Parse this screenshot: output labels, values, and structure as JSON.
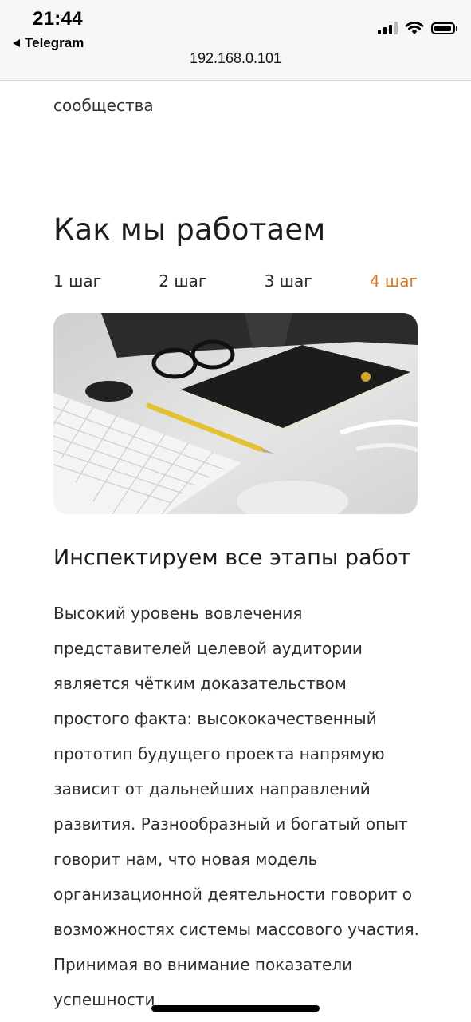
{
  "status_bar": {
    "time": "21:44",
    "back_app": "Telegram",
    "signal_icon": "cellular-signal-icon",
    "wifi_icon": "wifi-icon",
    "battery_icon": "battery-icon"
  },
  "browser": {
    "url": "192.168.0.101"
  },
  "intro": {
    "partial_text": "сообщества"
  },
  "how_we_work": {
    "title": "Как мы работаем",
    "steps": [
      {
        "label": "1 шаг",
        "active": false
      },
      {
        "label": "2 шаг",
        "active": false
      },
      {
        "label": "3 шаг",
        "active": false
      },
      {
        "label": "4 шаг",
        "active": true
      }
    ],
    "accent_color": "#d6761f",
    "card": {
      "image": "workspace-photo",
      "title": "Инспектируем все этапы работ",
      "text": "Высокий уровень вовлечения представителей целевой аудитории является чётким доказательством простого факта: высококачественный прототип будущего проекта напрямую зависит от дальнейших направлений развития. Разнообразный и богатый опыт говорит нам, что новая модель организационной деятельности говорит о возможностях системы массового участия. Принимая во внимание показатели успешности"
    }
  }
}
